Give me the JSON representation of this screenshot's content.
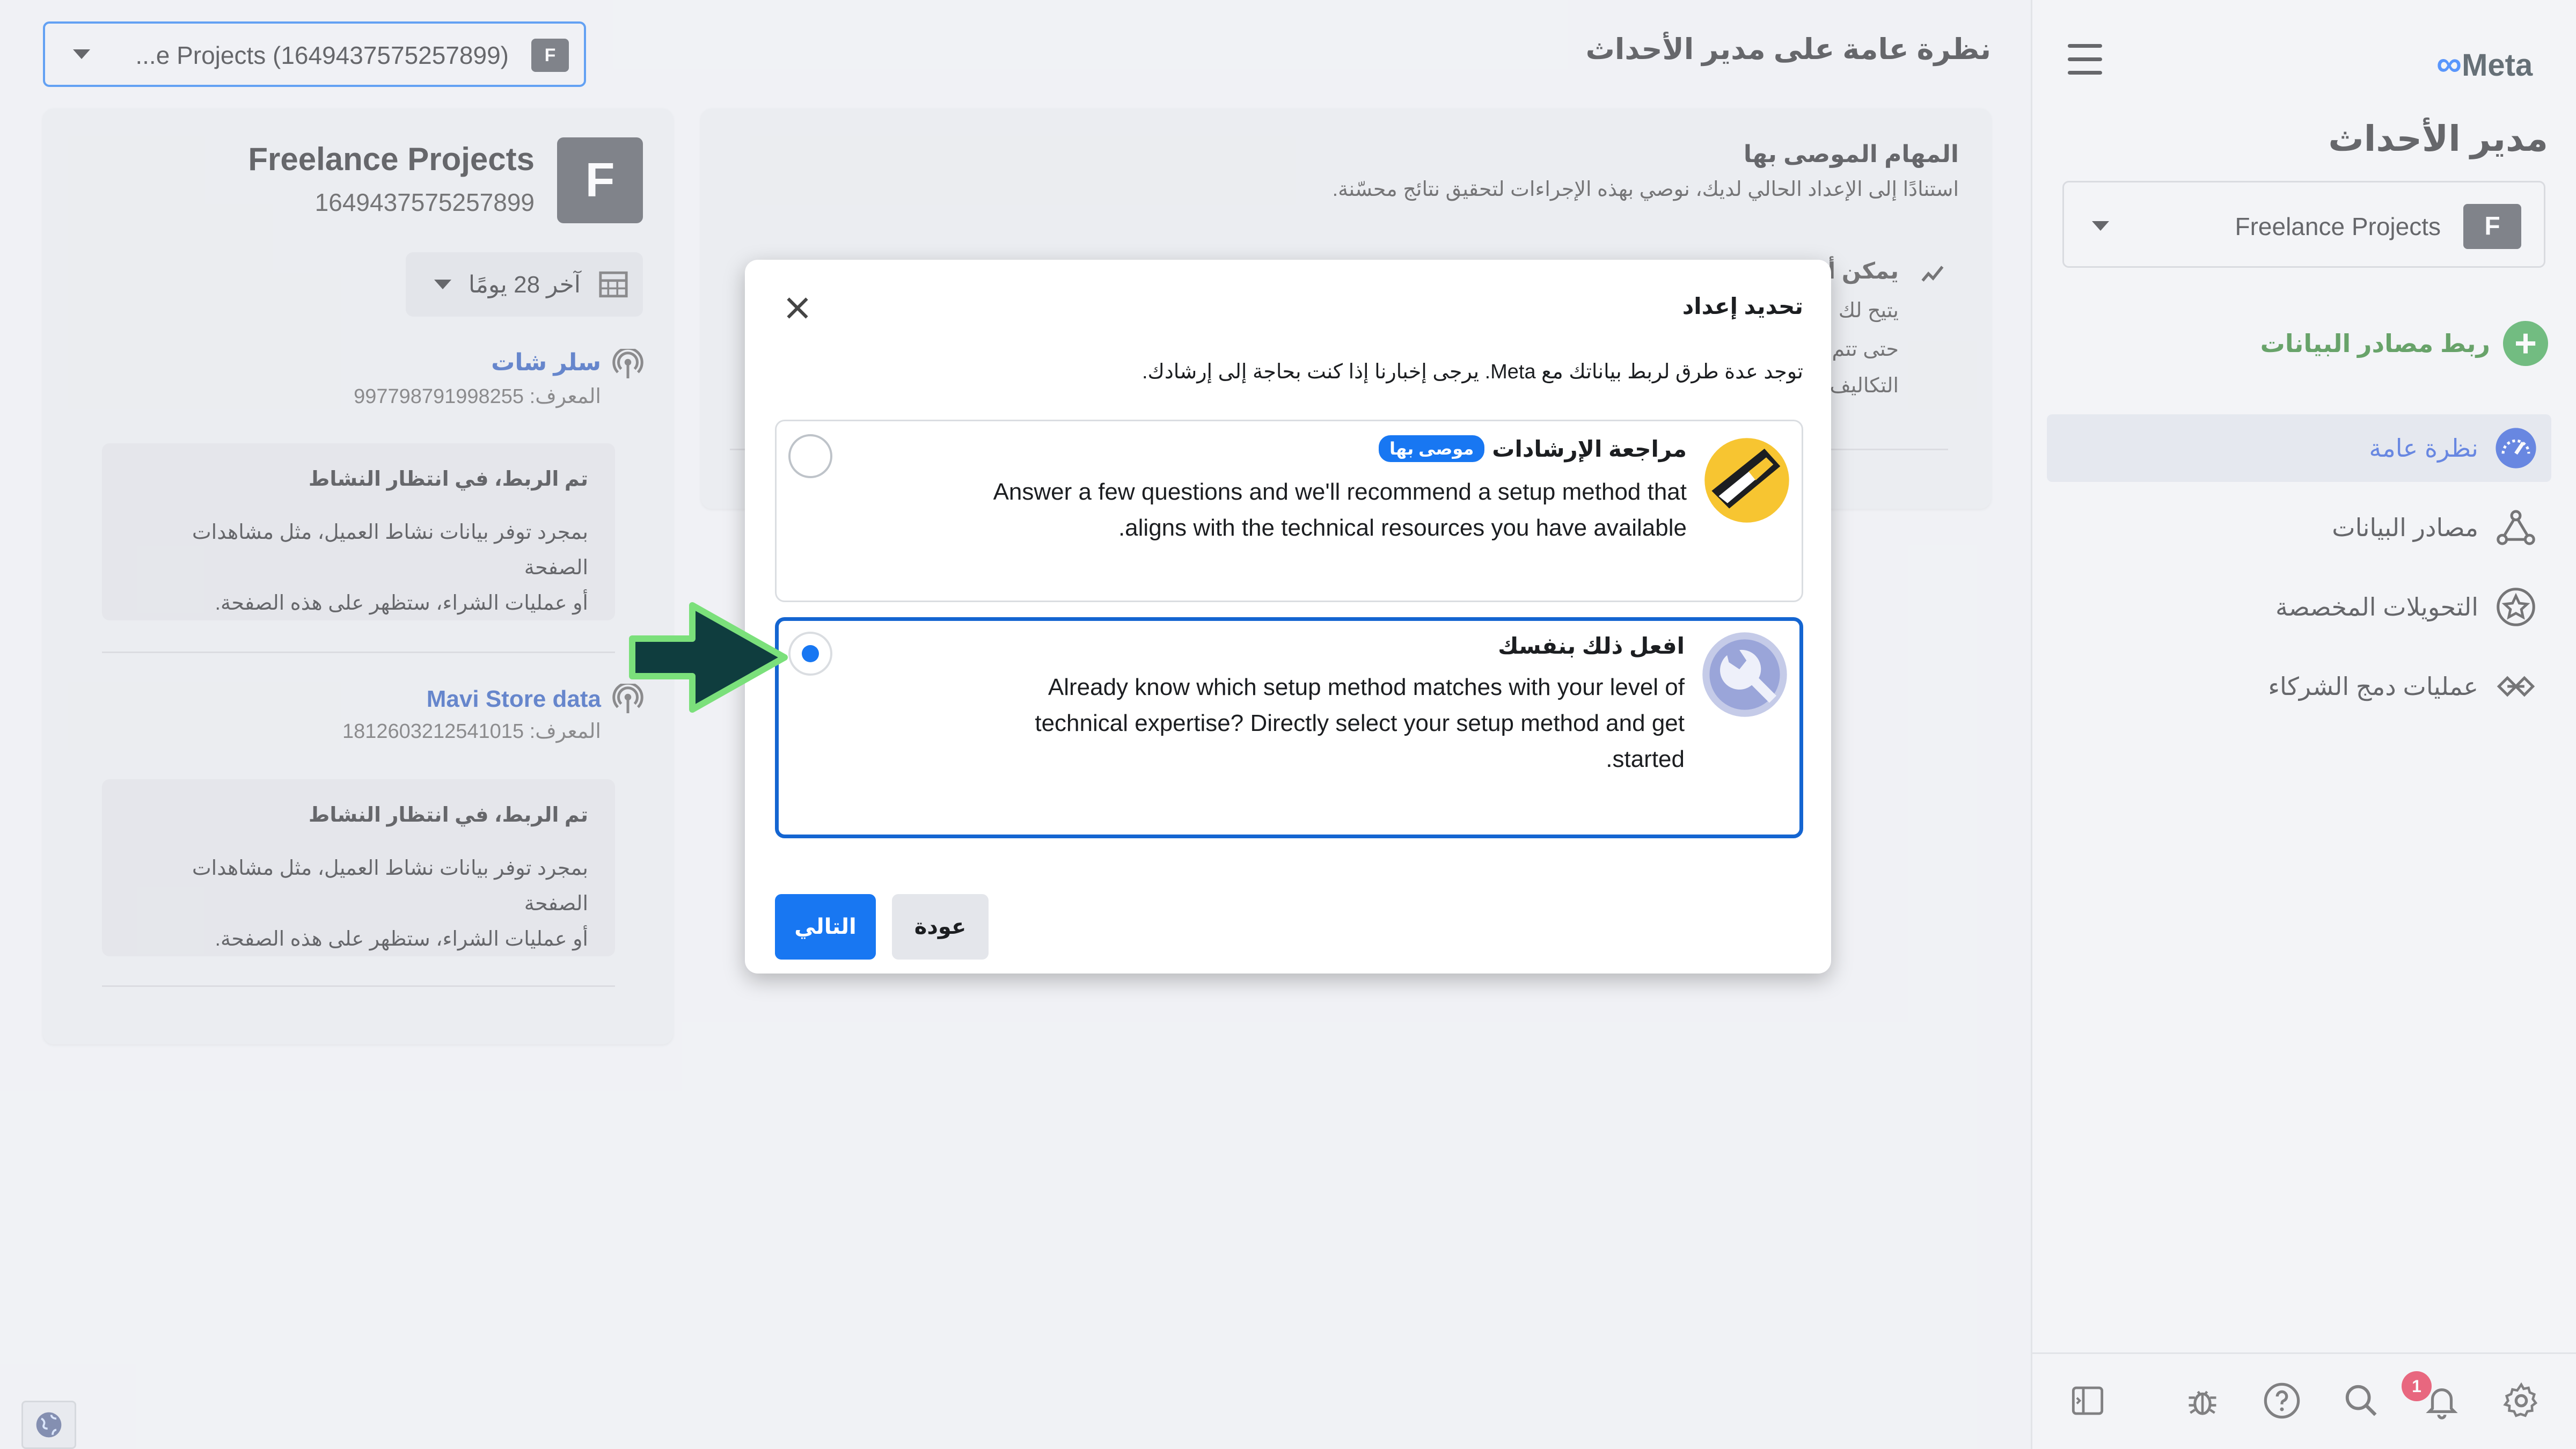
{
  "sidebar": {
    "brand": "Meta",
    "title": "مدير الأحداث",
    "account_select": {
      "label": "Freelance Projects",
      "avatar_letter": "F"
    },
    "connect_label": "ربط مصادر البيانات",
    "nav": [
      {
        "label": "نظرة عامة",
        "icon": "gauge-icon",
        "active": true
      },
      {
        "label": "مصادر البيانات",
        "icon": "data-sources-icon",
        "active": false
      },
      {
        "label": "التحويلات المخصصة",
        "icon": "star-circle-icon",
        "active": false
      },
      {
        "label": "عمليات دمج الشركاء",
        "icon": "handshake-icon",
        "active": false
      }
    ],
    "bottom": {
      "notification_count": "1"
    }
  },
  "header": {
    "page_title": "نظرة عامة على مدير الأحداث",
    "account_dropdown": {
      "label": "...e Projects (1649437575257899)",
      "avatar_letter": "F"
    }
  },
  "account_card": {
    "name": "Freelance Projects",
    "id": "1649437575257899",
    "avatar_letter": "F",
    "date_range": "آخر 28 يومًا",
    "pixels": [
      {
        "name": "سلر شات",
        "id_label": "المعرف: 997798791998255",
        "status_title": "تم الربط، في انتظار النشاط",
        "status_desc_1": "بمجرد توفر بيانات نشاط العميل، مثل مشاهدات الصفحة",
        "status_desc_2": "أو عمليات الشراء، ستظهر على هذه الصفحة."
      },
      {
        "name": "Mavi Store data",
        "id_label": "المعرف: 1812603212541015",
        "status_title": "تم الربط، في انتظار النشاط",
        "status_desc_1": "بمجرد توفر بيانات نشاط العميل، مثل مشاهدات الصفحة",
        "status_desc_2": "أو عمليات الشراء، ستظهر على هذه الصفحة."
      }
    ]
  },
  "tasks_card": {
    "title": "المهام الموصى بها",
    "subtitle": "استنادًا إلى الإعداد الحالي لديك، نوصي بهذه الإجراءات لتحقيق نتائج محسّنة.",
    "snippets": [
      "يمكن أ",
      "يتيح لك",
      "حتى تتم",
      "التكاليف"
    ]
  },
  "dialog": {
    "title": "تحديد إعداد",
    "description": "توجد عدة طرق لربط بياناتك مع Meta. يرجى إخبارنا إذا كنت بحاجة إلى إرشادك.",
    "options": [
      {
        "title": "مراجعة الإرشادات",
        "badge": "موصى بها",
        "line1": "Answer a few questions and we'll recommend a setup method that",
        "line2": "aligns with the technical resources you have available.",
        "selected": false
      },
      {
        "title": "افعل ذلك بنفسك",
        "line1": "Already know which setup method matches with your level of",
        "line2": "technical expertise? Directly select your setup method and get",
        "line3": "started.",
        "selected": true
      }
    ],
    "next_label": "التالي",
    "back_label": "عودة"
  },
  "colors": {
    "accent": "#1877f2",
    "selected_border": "#1465d1",
    "arrow_fill": "#0f3d3e",
    "arrow_outline": "#7be07b"
  }
}
